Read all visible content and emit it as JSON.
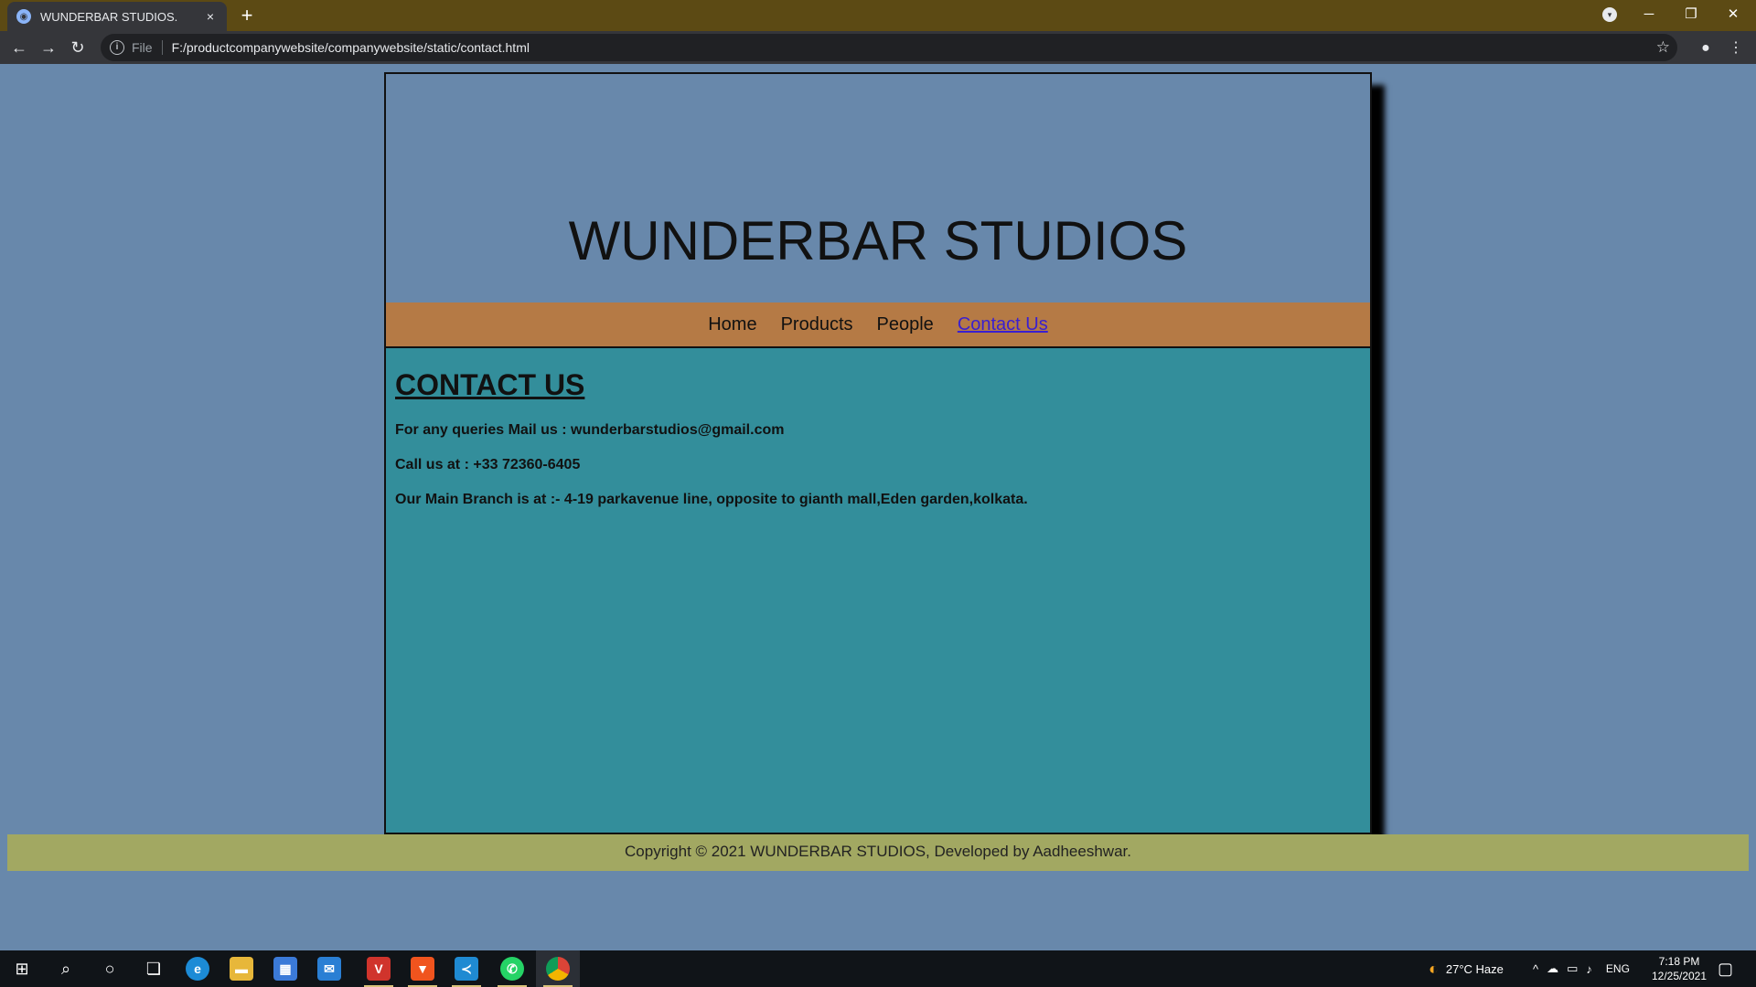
{
  "browser": {
    "tab_title": "WUNDERBAR STUDIOS.",
    "tab_close": "×",
    "new_tab": "+",
    "scheme": "File",
    "url": "F:/productcompanywebsite/companywebsite/static/contact.html"
  },
  "site": {
    "title": "WUNDERBAR STUDIOS",
    "nav": [
      {
        "label": "Home"
      },
      {
        "label": "Products"
      },
      {
        "label": "People"
      },
      {
        "label": "Contact Us"
      }
    ],
    "heading": "CONTACT US",
    "mail_line": "For any queries Mail us : wunderbarstudios@gmail.com",
    "call_line": "Call us at : +33 72360-6405",
    "branch_line": "Our Main Branch is at :- 4-19 parkavenue line, opposite to gianth mall,Eden garden,kolkata.",
    "footer": "Copyright © 2021 WUNDERBAR STUDIOS, Developed by Aadheeshwar."
  },
  "taskbar": {
    "weather": "27°C  Haze",
    "language": "ENG",
    "time": "7:18 PM",
    "date": "12/25/2021"
  },
  "colors": {
    "page_bg": "#6888ab",
    "nav_bg": "#b57a45",
    "content_bg": "#338e9b",
    "footer_bg": "#a2a862",
    "active_link": "#3a1fd0"
  }
}
